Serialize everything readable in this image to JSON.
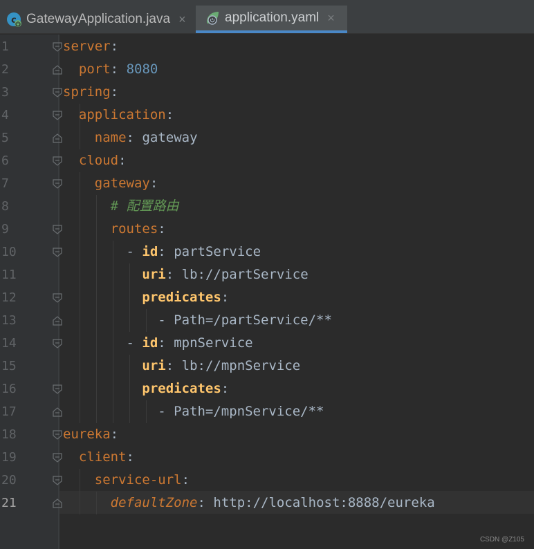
{
  "tabs": [
    {
      "label": "GatewayApplication.java",
      "close": "×",
      "icon": "spring-boot-java-icon",
      "active": false
    },
    {
      "label": "application.yaml",
      "close": "×",
      "icon": "spring-yaml-icon",
      "active": true
    }
  ],
  "editor": {
    "current_line": 21,
    "lines": [
      {
        "num": "1"
      },
      {
        "num": "2"
      },
      {
        "num": "3"
      },
      {
        "num": "4"
      },
      {
        "num": "5"
      },
      {
        "num": "6"
      },
      {
        "num": "7"
      },
      {
        "num": "8"
      },
      {
        "num": "9"
      },
      {
        "num": "10"
      },
      {
        "num": "11"
      },
      {
        "num": "12"
      },
      {
        "num": "13"
      },
      {
        "num": "14"
      },
      {
        "num": "15"
      },
      {
        "num": "16"
      },
      {
        "num": "17"
      },
      {
        "num": "18"
      },
      {
        "num": "19"
      },
      {
        "num": "20"
      },
      {
        "num": "21"
      }
    ],
    "code": {
      "l1_key": "server",
      "colon": ":",
      "l2_key": "port",
      "l2_val": "8080",
      "l3_key": "spring",
      "l4_key": "application",
      "l5_key": "name",
      "l5_val": "gateway",
      "l6_key": "cloud",
      "l7_key": "gateway",
      "l8_comment": "# 配置路由",
      "l9_key": "routes",
      "l10_dash": "- ",
      "l10_key": "id",
      "l10_val": "partService",
      "l11_key": "uri",
      "l11_val": "lb://partService",
      "l12_key": "predicates",
      "l13_val": "- Path=/partService/**",
      "l14_dash": "- ",
      "l14_key": "id",
      "l14_val": "mpnService",
      "l15_key": "uri",
      "l15_val": "lb://mpnService",
      "l16_key": "predicates",
      "l17_val": "- Path=/mpnService/**",
      "l18_key": "eureka",
      "l19_key": "client",
      "l20_key": "service-url",
      "l21_key": "defaultZone",
      "l21_val": "http://localhost:8888/eureka"
    }
  },
  "watermark": "CSDN @Z105",
  "colors": {
    "background": "#2b2b2b",
    "keyword": "#cc7832",
    "bold_key": "#ffc66d",
    "number": "#6897bb",
    "comment": "#629755",
    "text": "#a9b7c6",
    "tab_accent": "#4a88c7"
  }
}
